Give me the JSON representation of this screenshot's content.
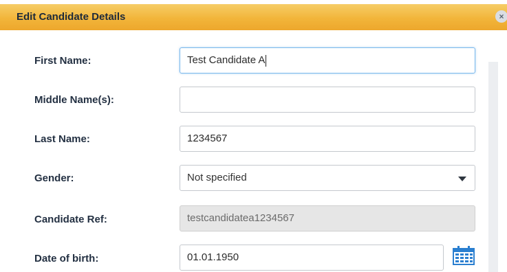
{
  "dialog": {
    "title": "Edit Candidate Details",
    "close_label": "×"
  },
  "form": {
    "first_name": {
      "label": "First Name:",
      "value": "Test Candidate A"
    },
    "middle_names": {
      "label": "Middle Name(s):",
      "value": ""
    },
    "last_name": {
      "label": "Last Name:",
      "value": "1234567"
    },
    "gender": {
      "label": "Gender:",
      "value": "Not specified"
    },
    "candidate_ref": {
      "label": "Candidate Ref:",
      "value": "testcandidatea1234567"
    },
    "date_of_birth": {
      "label": "Date of birth:",
      "value": "01.01.1950"
    }
  },
  "icons": {
    "close": "close-icon",
    "dropdown": "chevron-down-icon",
    "calendar": "calendar-icon"
  },
  "colors": {
    "titlebar": "#f2b53a",
    "focus_border": "#7ab8ec",
    "calendar_icon": "#2a7fd0"
  }
}
